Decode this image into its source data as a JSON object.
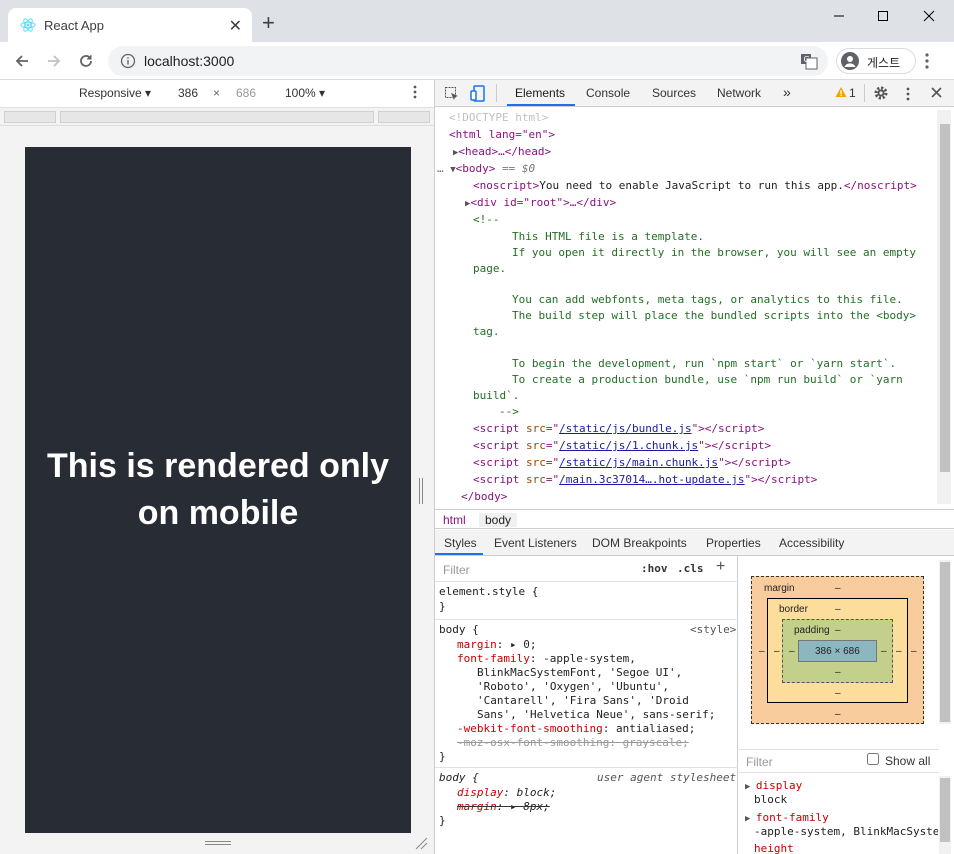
{
  "browser": {
    "tab_title": "React App",
    "new_tab_symbol": "+",
    "url": "localhost:3000",
    "profile_label": "게스트"
  },
  "device_toolbar": {
    "mode": "Responsive ▾",
    "width_value": "386",
    "times": "×",
    "height_value": "686",
    "zoom": "100% ▾"
  },
  "page": {
    "heading": "This is rendered only on mobile"
  },
  "devtools": {
    "tabs": [
      "Elements",
      "Console",
      "Sources",
      "Network"
    ],
    "more_tabs": "»",
    "warning_count": "1",
    "dom_lines": {
      "doctype": "<!DOCTYPE html>",
      "html_open": "<html lang=\"en\">",
      "head": "<head>…</head>",
      "body_dots": "…",
      "body_open": "<body>",
      "body_eq": " == $0",
      "noscript_text": "You need to enable JavaScript to run this app.",
      "div_root": "<div id=\"root\">…</div>",
      "comment_open": "<!--",
      "comment_1": "This HTML file is a template.",
      "comment_2": "If you open it directly in the browser, you will see an empty",
      "comment_3": "page.",
      "comment_4": "You can add webfonts, meta tags, or analytics to this file.",
      "comment_5": "The build step will place the bundled scripts into the <body>",
      "comment_6": "tag.",
      "comment_7": "To begin the development, run `npm start` or `yarn start`.",
      "comment_8": "To create a production bundle, use `npm run build` or `yarn",
      "comment_9": "build`.",
      "comment_close": "-->",
      "scripts": [
        "/static/js/bundle.js",
        "/static/js/1.chunk.js",
        "/static/js/main.chunk.js",
        "/main.3c37014….hot-update.js"
      ],
      "body_close": "</body>"
    },
    "breadcrumbs": [
      "html",
      "body"
    ],
    "sub_tabs": [
      "Styles",
      "Event Listeners",
      "DOM Breakpoints",
      "Properties",
      "Accessibility"
    ],
    "styles": {
      "filter_placeholder": "Filter",
      "hov": ":hov",
      "cls": ".cls",
      "add": "+",
      "element_style": "element.style {",
      "close_brace": "}",
      "body_selector": "body {",
      "body_source": "<style>",
      "margin_prop": "margin",
      "margin_val": "0;",
      "font_family_prop": "font-family",
      "font_family_val_1": "-apple-system,",
      "font_family_val_2": "BlinkMacSystemFont, 'Segoe UI',",
      "font_family_val_3": "'Roboto', 'Oxygen', 'Ubuntu',",
      "font_family_val_4": "'Cantarell', 'Fira Sans', 'Droid",
      "font_family_val_5": "Sans', 'Helvetica Neue', sans-serif;",
      "webkit_prop": "-webkit-font-smoothing",
      "webkit_val": "antialiased;",
      "moz_line": "-moz-osx-font-smoothing: grayscale;",
      "ua_selector": "body {",
      "ua_source": "user agent stylesheet",
      "display_prop": "display",
      "display_val": "block;",
      "ua_margin_prop": "margin",
      "ua_margin_val": "8px;"
    },
    "box_model": {
      "margin_label": "margin",
      "border_label": "border",
      "padding_label": "padding",
      "dash": "–",
      "content_size": "386 × 686"
    },
    "computed": {
      "filter_placeholder": "Filter",
      "show_all": "Show all",
      "props": [
        {
          "name": "display",
          "value": "block"
        },
        {
          "name": "font-family",
          "value": "-apple-system, BlinkMacSyste"
        },
        {
          "name": "height",
          "value": ""
        }
      ]
    }
  }
}
